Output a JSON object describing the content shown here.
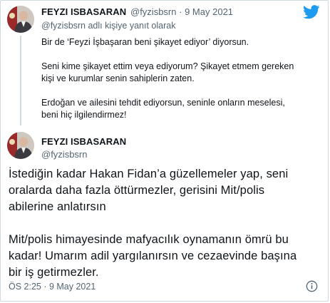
{
  "reply_tweet": {
    "display_name": "FEYZI ISBASARAN",
    "handle": "@fyzisbsrn",
    "separator": "·",
    "date": "9 May 2021",
    "replying_to": "@fyzisbsrn adlı kişiye yanıt olarak",
    "paragraphs": [
      [
        "Bir de ‘Feyzi İşbaşaran beni şikayet ediyor’ diyorsun."
      ],
      [
        "Seni kime şikayet ettim veya ediyorum? Şikayet etmem gereken",
        "kişi ve kurumlar senin sahiplerin zaten."
      ],
      [
        "Erdoğan ve ailesini tehdit ediyorsun, seninle onların meselesi,",
        "beni hiç ilgilendirmez!"
      ]
    ]
  },
  "main_tweet": {
    "display_name": "FEYZI ISBASARAN",
    "handle": "@fyzisbsrn",
    "paragraphs": [
      [
        "İstediğin kadar Hakan Fidan’a güzellemeler yap, seni",
        "oralarda daha fazla öttürmezler, gerisini Mit/polis",
        "abilerine anlatırsın"
      ],
      [
        "Mit/polis himayesinde mafyacılık oynamanın ömrü bu",
        "kadar! Umarım adil yargılanırsın ve cezaevinde başına",
        "bir iş getirmezler."
      ]
    ],
    "timestamp": "ÖS 2:25 · 9 May 2021"
  },
  "icons": {
    "brand": "twitter-bird-icon",
    "info": "info-icon"
  },
  "colors": {
    "twitter_blue": "#1d9bf0",
    "muted_text": "#536471",
    "body_text": "#0f1419",
    "divider": "#cfd9de"
  }
}
